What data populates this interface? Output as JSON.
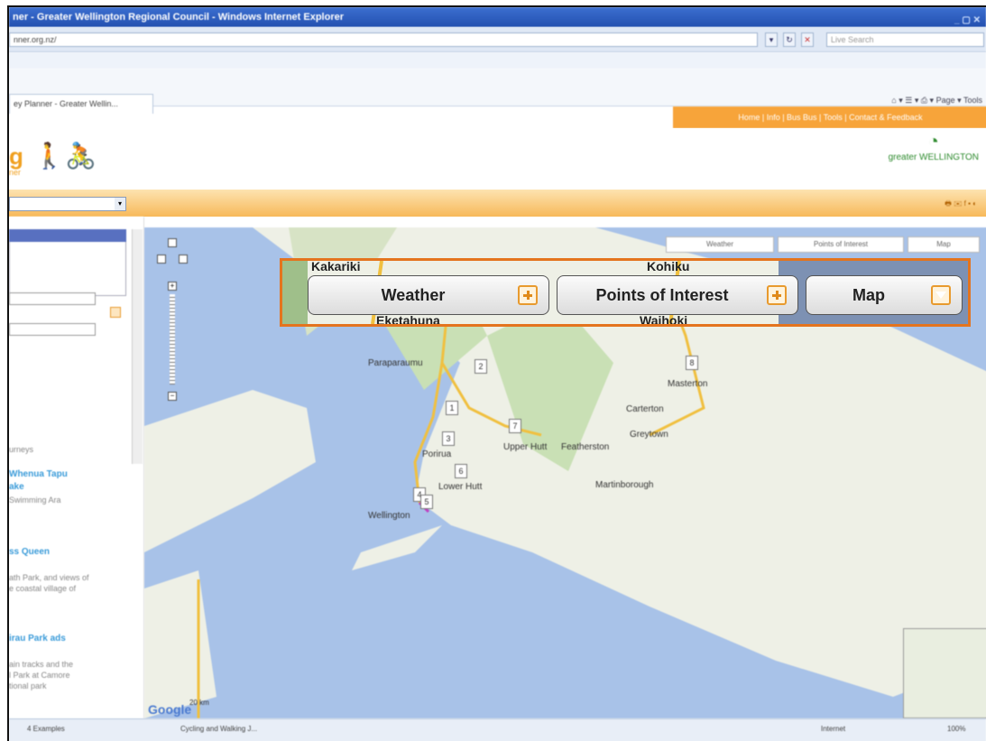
{
  "window": {
    "title": "ner - Greater Wellington Regional Council - Windows Internet Explorer"
  },
  "address": {
    "url": "nner.org.nz/",
    "search_placeholder": "Live Search"
  },
  "tab": {
    "label": "ey Planner - Greater Wellin..."
  },
  "command_bar": {
    "page": "Page",
    "tools": "Tools"
  },
  "site": {
    "nav": "Home | Info | Bus Bus | Tools | Contact & Feedback",
    "logo_fragment": "g",
    "logo_sub": "ner",
    "gw_logo": "greater WELLINGTON"
  },
  "sidebar": {
    "text_journeys": "urneys",
    "link_1": "Whenua Tapu",
    "link_1b": "ake",
    "text_1": "Swimming Ara",
    "link_2": "ss Queen",
    "text_2a": "ath Park, and views of",
    "text_2b": "e coastal village of",
    "link_3": "irau Park ads",
    "text_3a": "ain tracks and the",
    "text_3b": "l Park at Camore",
    "text_3c": "tional park"
  },
  "map": {
    "tabs": [
      "Weather",
      "Points of Interest",
      "Map"
    ],
    "places": [
      "Kakariki",
      "Kohiku",
      "Eketahuna",
      "Waihoki",
      "Paraparaumu",
      "Upper Hutt",
      "Porirua",
      "Lower Hutt",
      "Wellington",
      "Masterton",
      "Carterton",
      "Greytown",
      "Featherston",
      "Martinborough"
    ],
    "markers": [
      "2",
      "8",
      "1",
      "7",
      "3",
      "6",
      "4",
      "5"
    ],
    "scale": "20 km",
    "google": "Google"
  },
  "callout": {
    "weather": "Weather",
    "poi": "Points of Interest",
    "map": "Map",
    "bg_left_top": "Kakariki",
    "bg_left_bottom": "Eketahuna",
    "bg_center_top": "Kohiku",
    "bg_center_bottom": "Waihoki"
  },
  "status": {
    "tab_1": "4 Examples",
    "tab_2": "Cycling and Walking J...",
    "zone": "Internet",
    "zoom": "100%"
  }
}
